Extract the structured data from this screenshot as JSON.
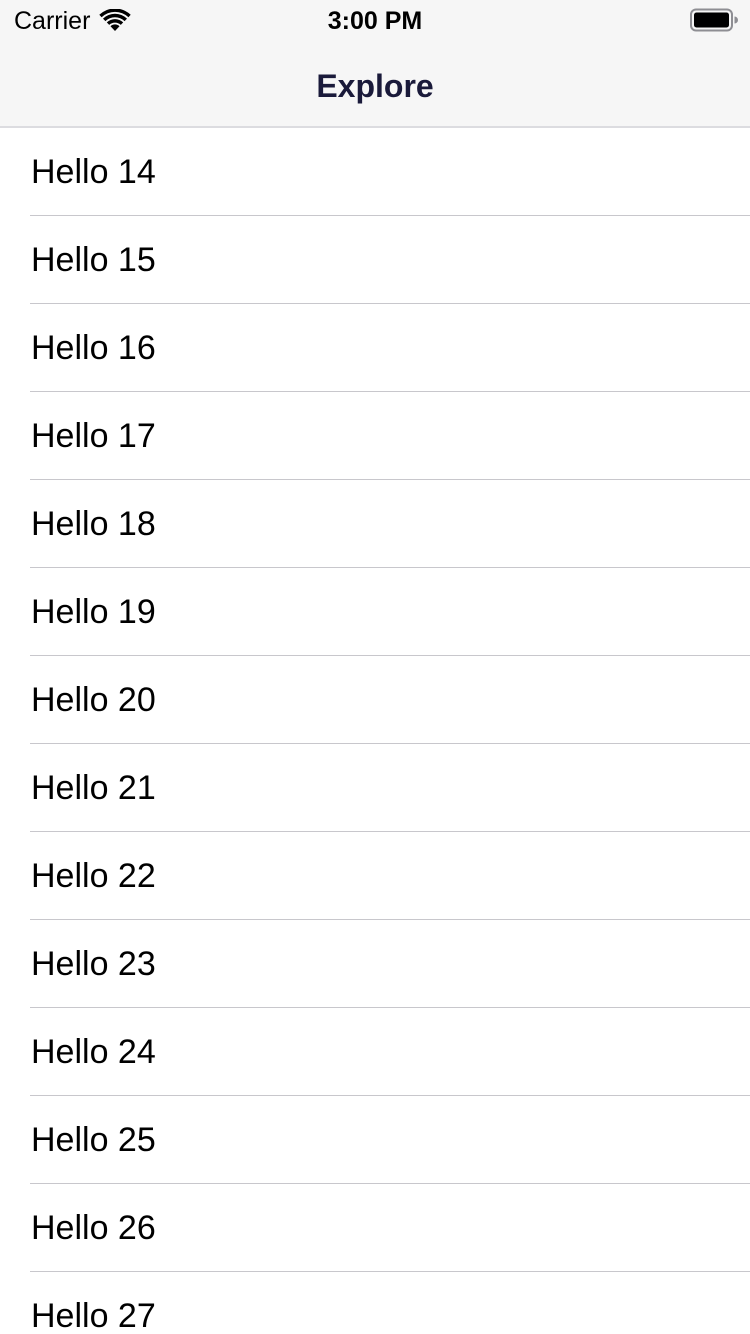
{
  "status_bar": {
    "carrier": "Carrier",
    "time": "3:00 PM",
    "wifi_icon": "wifi-icon",
    "battery_icon": "battery-icon"
  },
  "nav": {
    "title": "Explore"
  },
  "list": {
    "items": [
      {
        "label": "Hello 14"
      },
      {
        "label": "Hello 15"
      },
      {
        "label": "Hello 16"
      },
      {
        "label": "Hello 17"
      },
      {
        "label": "Hello 18"
      },
      {
        "label": "Hello 19"
      },
      {
        "label": "Hello 20"
      },
      {
        "label": "Hello 21"
      },
      {
        "label": "Hello 22"
      },
      {
        "label": "Hello 23"
      },
      {
        "label": "Hello 24"
      },
      {
        "label": "Hello 25"
      },
      {
        "label": "Hello 26"
      },
      {
        "label": "Hello 27"
      }
    ]
  },
  "colors": {
    "nav_background": "#f6f6f6",
    "title_color": "#1a1a3a",
    "separator": "#c8c7cc"
  }
}
